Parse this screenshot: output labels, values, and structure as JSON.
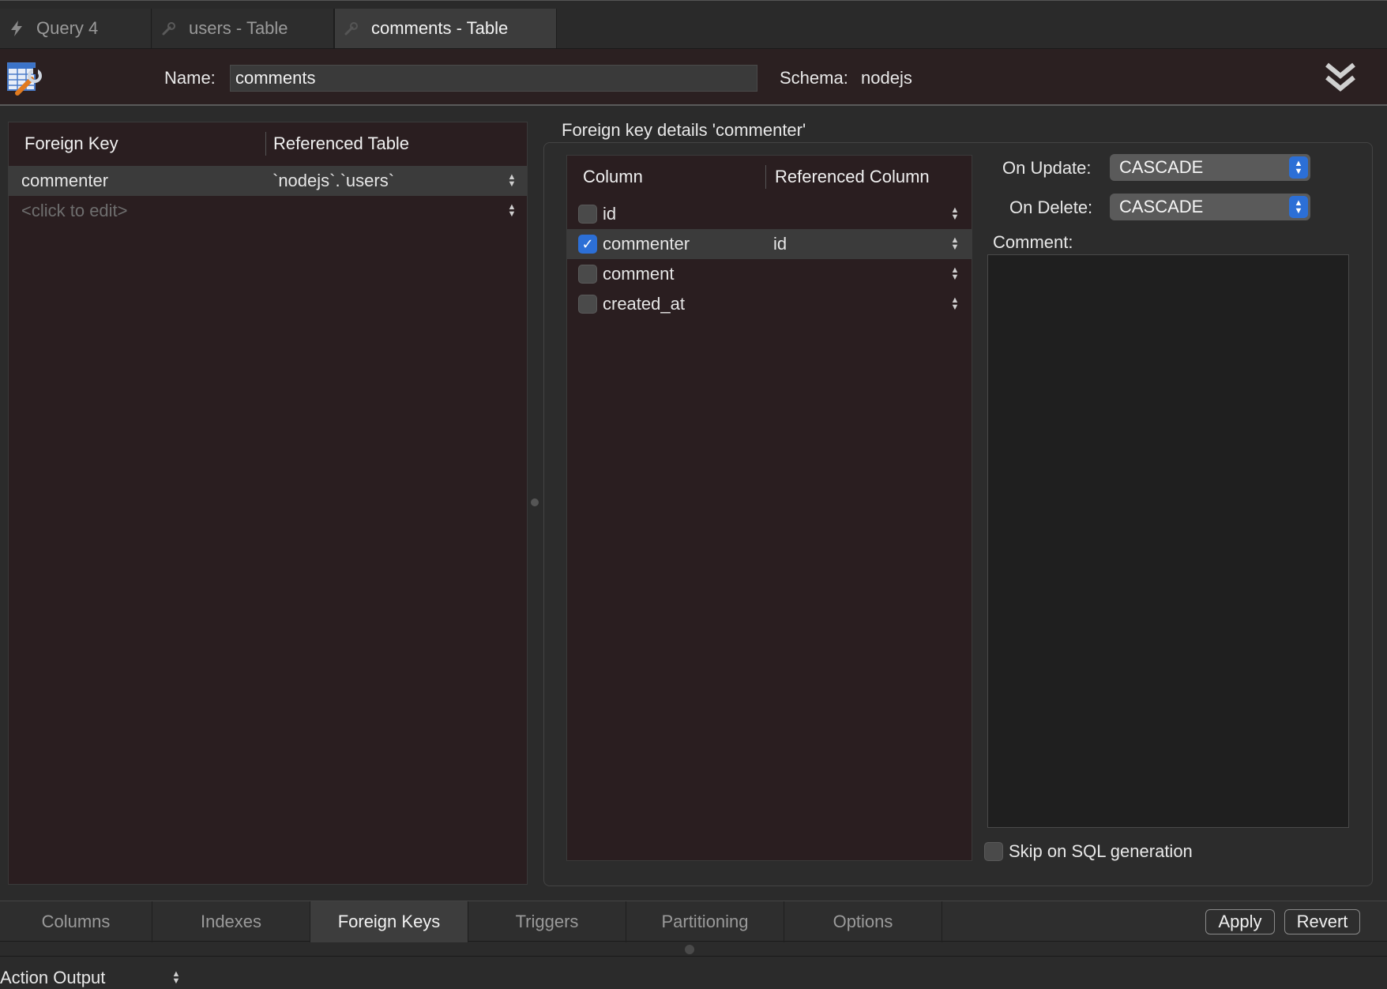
{
  "tabs": [
    {
      "label": "Query 4",
      "icon": "lightning-icon",
      "active": false
    },
    {
      "label": "users - Table",
      "icon": "wrench-icon",
      "active": false
    },
    {
      "label": "comments - Table",
      "icon": "wrench-icon",
      "active": true
    }
  ],
  "header": {
    "name_label": "Name:",
    "name_value": "comments",
    "schema_label": "Schema:",
    "schema_value": "nodejs"
  },
  "fk_list": {
    "headers": [
      "Foreign Key",
      "Referenced Table"
    ],
    "rows": [
      {
        "name": "commenter",
        "ref_table": "`nodejs`.`users`",
        "selected": true
      },
      {
        "name": "<click to edit>",
        "ref_table": "",
        "selected": false,
        "placeholder": true
      }
    ]
  },
  "details": {
    "title": "Foreign key details 'commenter'",
    "column_headers": [
      "Column",
      "Referenced Column"
    ],
    "columns": [
      {
        "name": "id",
        "ref": "",
        "checked": false,
        "selected": false
      },
      {
        "name": "commenter",
        "ref": "id",
        "checked": true,
        "selected": true
      },
      {
        "name": "comment",
        "ref": "",
        "checked": false,
        "selected": false
      },
      {
        "name": "created_at",
        "ref": "",
        "checked": false,
        "selected": false
      }
    ],
    "on_update_label": "On Update:",
    "on_update_value": "CASCADE",
    "on_delete_label": "On Delete:",
    "on_delete_value": "CASCADE",
    "comment_label": "Comment:",
    "comment_value": "",
    "skip_label": "Skip on SQL generation",
    "skip_checked": false
  },
  "bottom_tabs": [
    {
      "label": "Columns",
      "active": false
    },
    {
      "label": "Indexes",
      "active": false
    },
    {
      "label": "Foreign Keys",
      "active": true
    },
    {
      "label": "Triggers",
      "active": false
    },
    {
      "label": "Partitioning",
      "active": false
    },
    {
      "label": "Options",
      "active": false
    }
  ],
  "buttons": {
    "apply": "Apply",
    "revert": "Revert"
  },
  "action_output": {
    "label": "Action Output"
  },
  "colors": {
    "accent": "#2c6fd6",
    "panel": "#2a1e20",
    "selected_row": "#3b3b3b"
  }
}
